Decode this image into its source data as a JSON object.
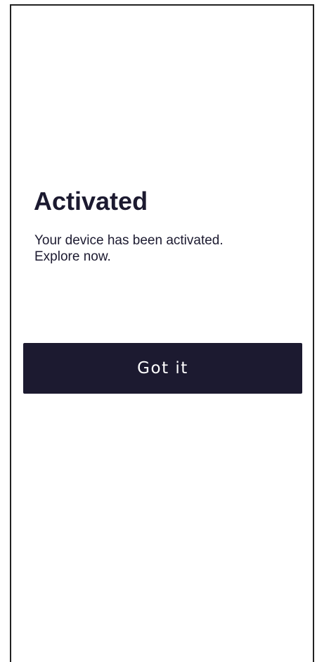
{
  "activation": {
    "title": "Activated",
    "message_line1": "Your device has been activated.",
    "message_line2": "Explore now.",
    "button_label": "Got it"
  },
  "colors": {
    "accent": "#1c1a30",
    "background": "#ffffff",
    "button_text": "#ffffff"
  }
}
